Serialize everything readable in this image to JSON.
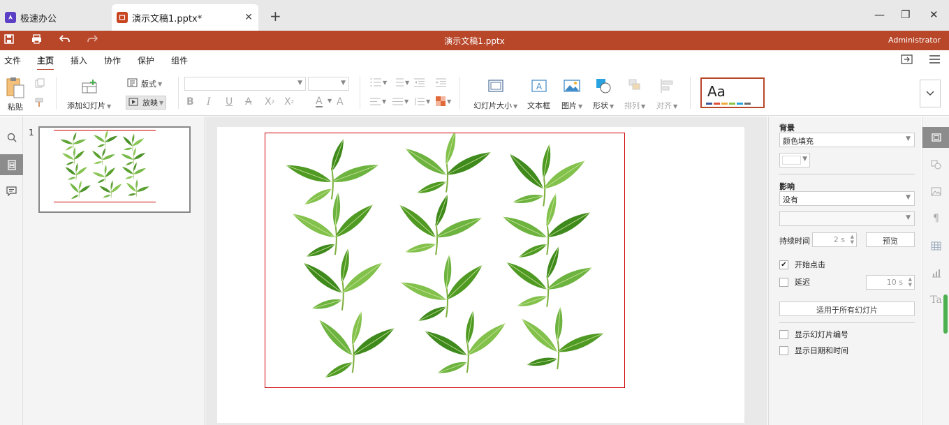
{
  "tabs": [
    {
      "label": "极速办公",
      "icon": "rocket-icon",
      "color": "#5b3fc4"
    },
    {
      "label": "演示文稿1.pptx*",
      "icon": "presentation-icon",
      "color": "#c7451f",
      "close": "✕"
    }
  ],
  "new_tab": "+",
  "window_controls": {
    "minimize": "—",
    "restore": "❐",
    "close": "✕"
  },
  "titlebar": {
    "title": "演示文稿1.pptx",
    "user": "Administrator",
    "accent": "#b8472a"
  },
  "menu": {
    "items": [
      "文件",
      "主页",
      "插入",
      "协作",
      "保护",
      "组件"
    ],
    "active": "主页"
  },
  "ribbon": {
    "paste": "粘贴",
    "add_slide": "添加幻灯片",
    "layout": "版式",
    "play": "放映",
    "slide_size": "幻灯片大小",
    "textbox": "文本框",
    "image": "图片",
    "shape": "形状",
    "arrange": "排列",
    "align": "对齐",
    "theme_sample": "Aa"
  },
  "slides": [
    {
      "number": "1"
    }
  ],
  "right_panel": {
    "background_title": "背景",
    "background_value": "颜色填充",
    "transition_title": "影响",
    "transition_value": "没有",
    "duration_label": "持续时间",
    "duration_value": "2 s",
    "preview_btn": "预览",
    "start_on_click": "开始点击",
    "start_on_click_checked": true,
    "delay_label": "延迟",
    "delay_checked": false,
    "delay_value": "10 s",
    "apply_all_btn": "适用于所有幻灯片",
    "show_slide_number": "显示幻灯片编号",
    "show_date_time": "显示日期和时间"
  }
}
